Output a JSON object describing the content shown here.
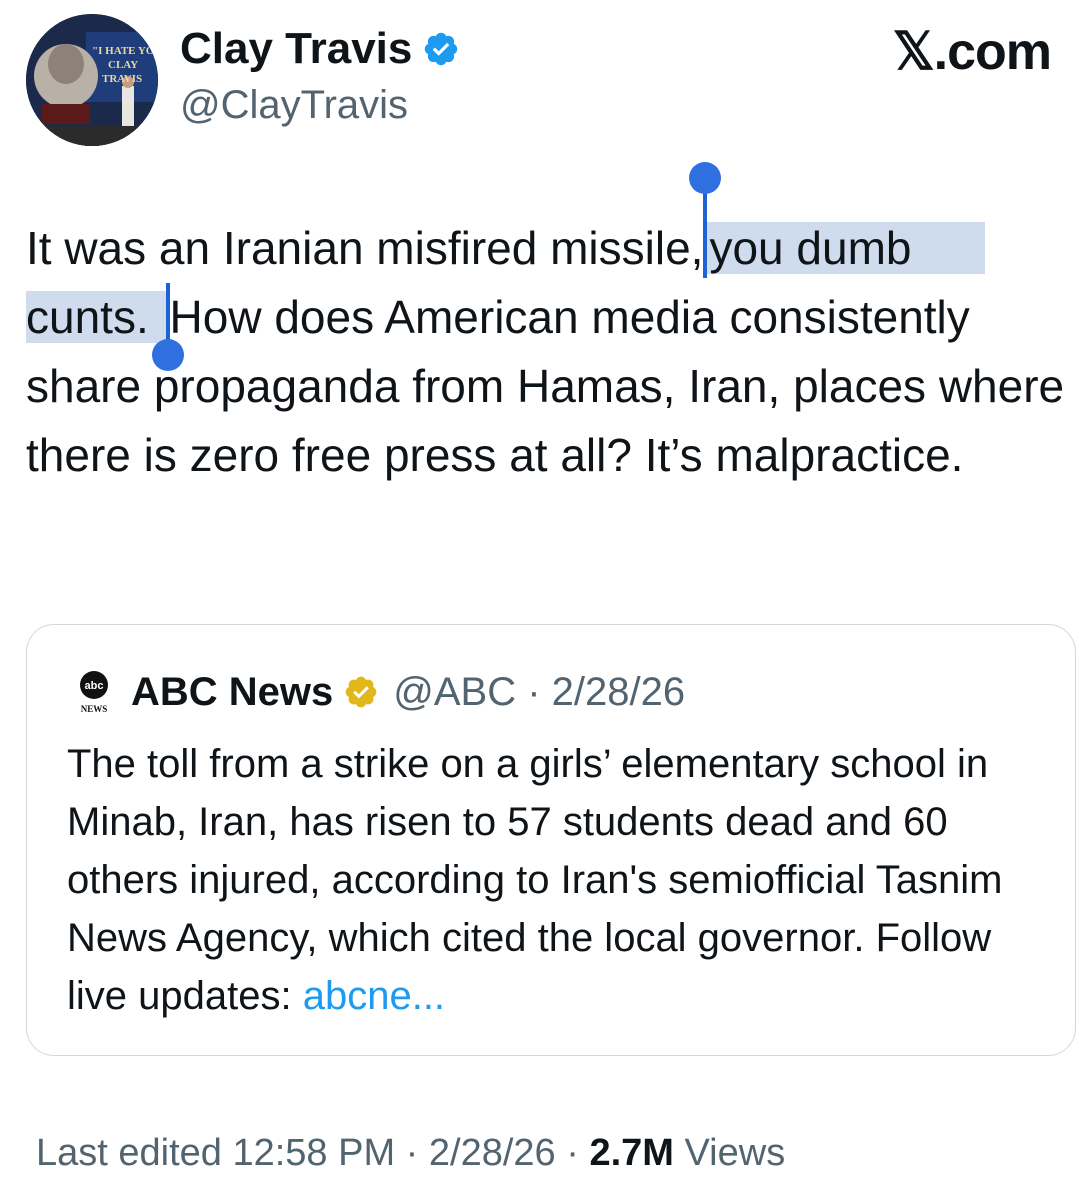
{
  "author": {
    "display_name": "Clay Travis",
    "handle": "@ClayTravis",
    "verified_badge": "verified-blue-badge-icon",
    "avatar_sign_text": "\"I HATE YOU CLAY TRAVIS\""
  },
  "brand": {
    "label": "𝕏.com"
  },
  "tweet": {
    "text_before_selection": "It was an Iranian misfired missile,",
    "selected_text_line1": "you dumb",
    "selected_text_line2": "cunts.",
    "text_after_selection": "How does American media consistently share propaganda from Hamas, Iran, places where there is zero free press at all? It’s malpractice."
  },
  "quote": {
    "logo_text": "abc",
    "logo_sub": "NEWS",
    "name": "ABC News",
    "badge": "verified-gold-badge-icon",
    "meta": "@ABC · 2/28/26",
    "text": "The toll from a strike on a girls’ elementary school in Minab, Iran, has risen to 57 students dead and 60 others injured, according to Iran's semiofficial Tasnim News Agency, which cited the local governor. Follow live updates:",
    "link_text": "abcne...",
    "link_color": "#1d9bf0"
  },
  "footer": {
    "edited_label": "Last edited 12:58 PM · 2/28/26 ·",
    "views_count": "2.7M",
    "views_label": "Views"
  },
  "colors": {
    "text": "#0f1419",
    "secondary": "#536471",
    "selection": "#cfdcee",
    "selection_handle": "#2f6fe0",
    "verified_blue": "#1d9bf0",
    "verified_gold": "#e2b719"
  }
}
